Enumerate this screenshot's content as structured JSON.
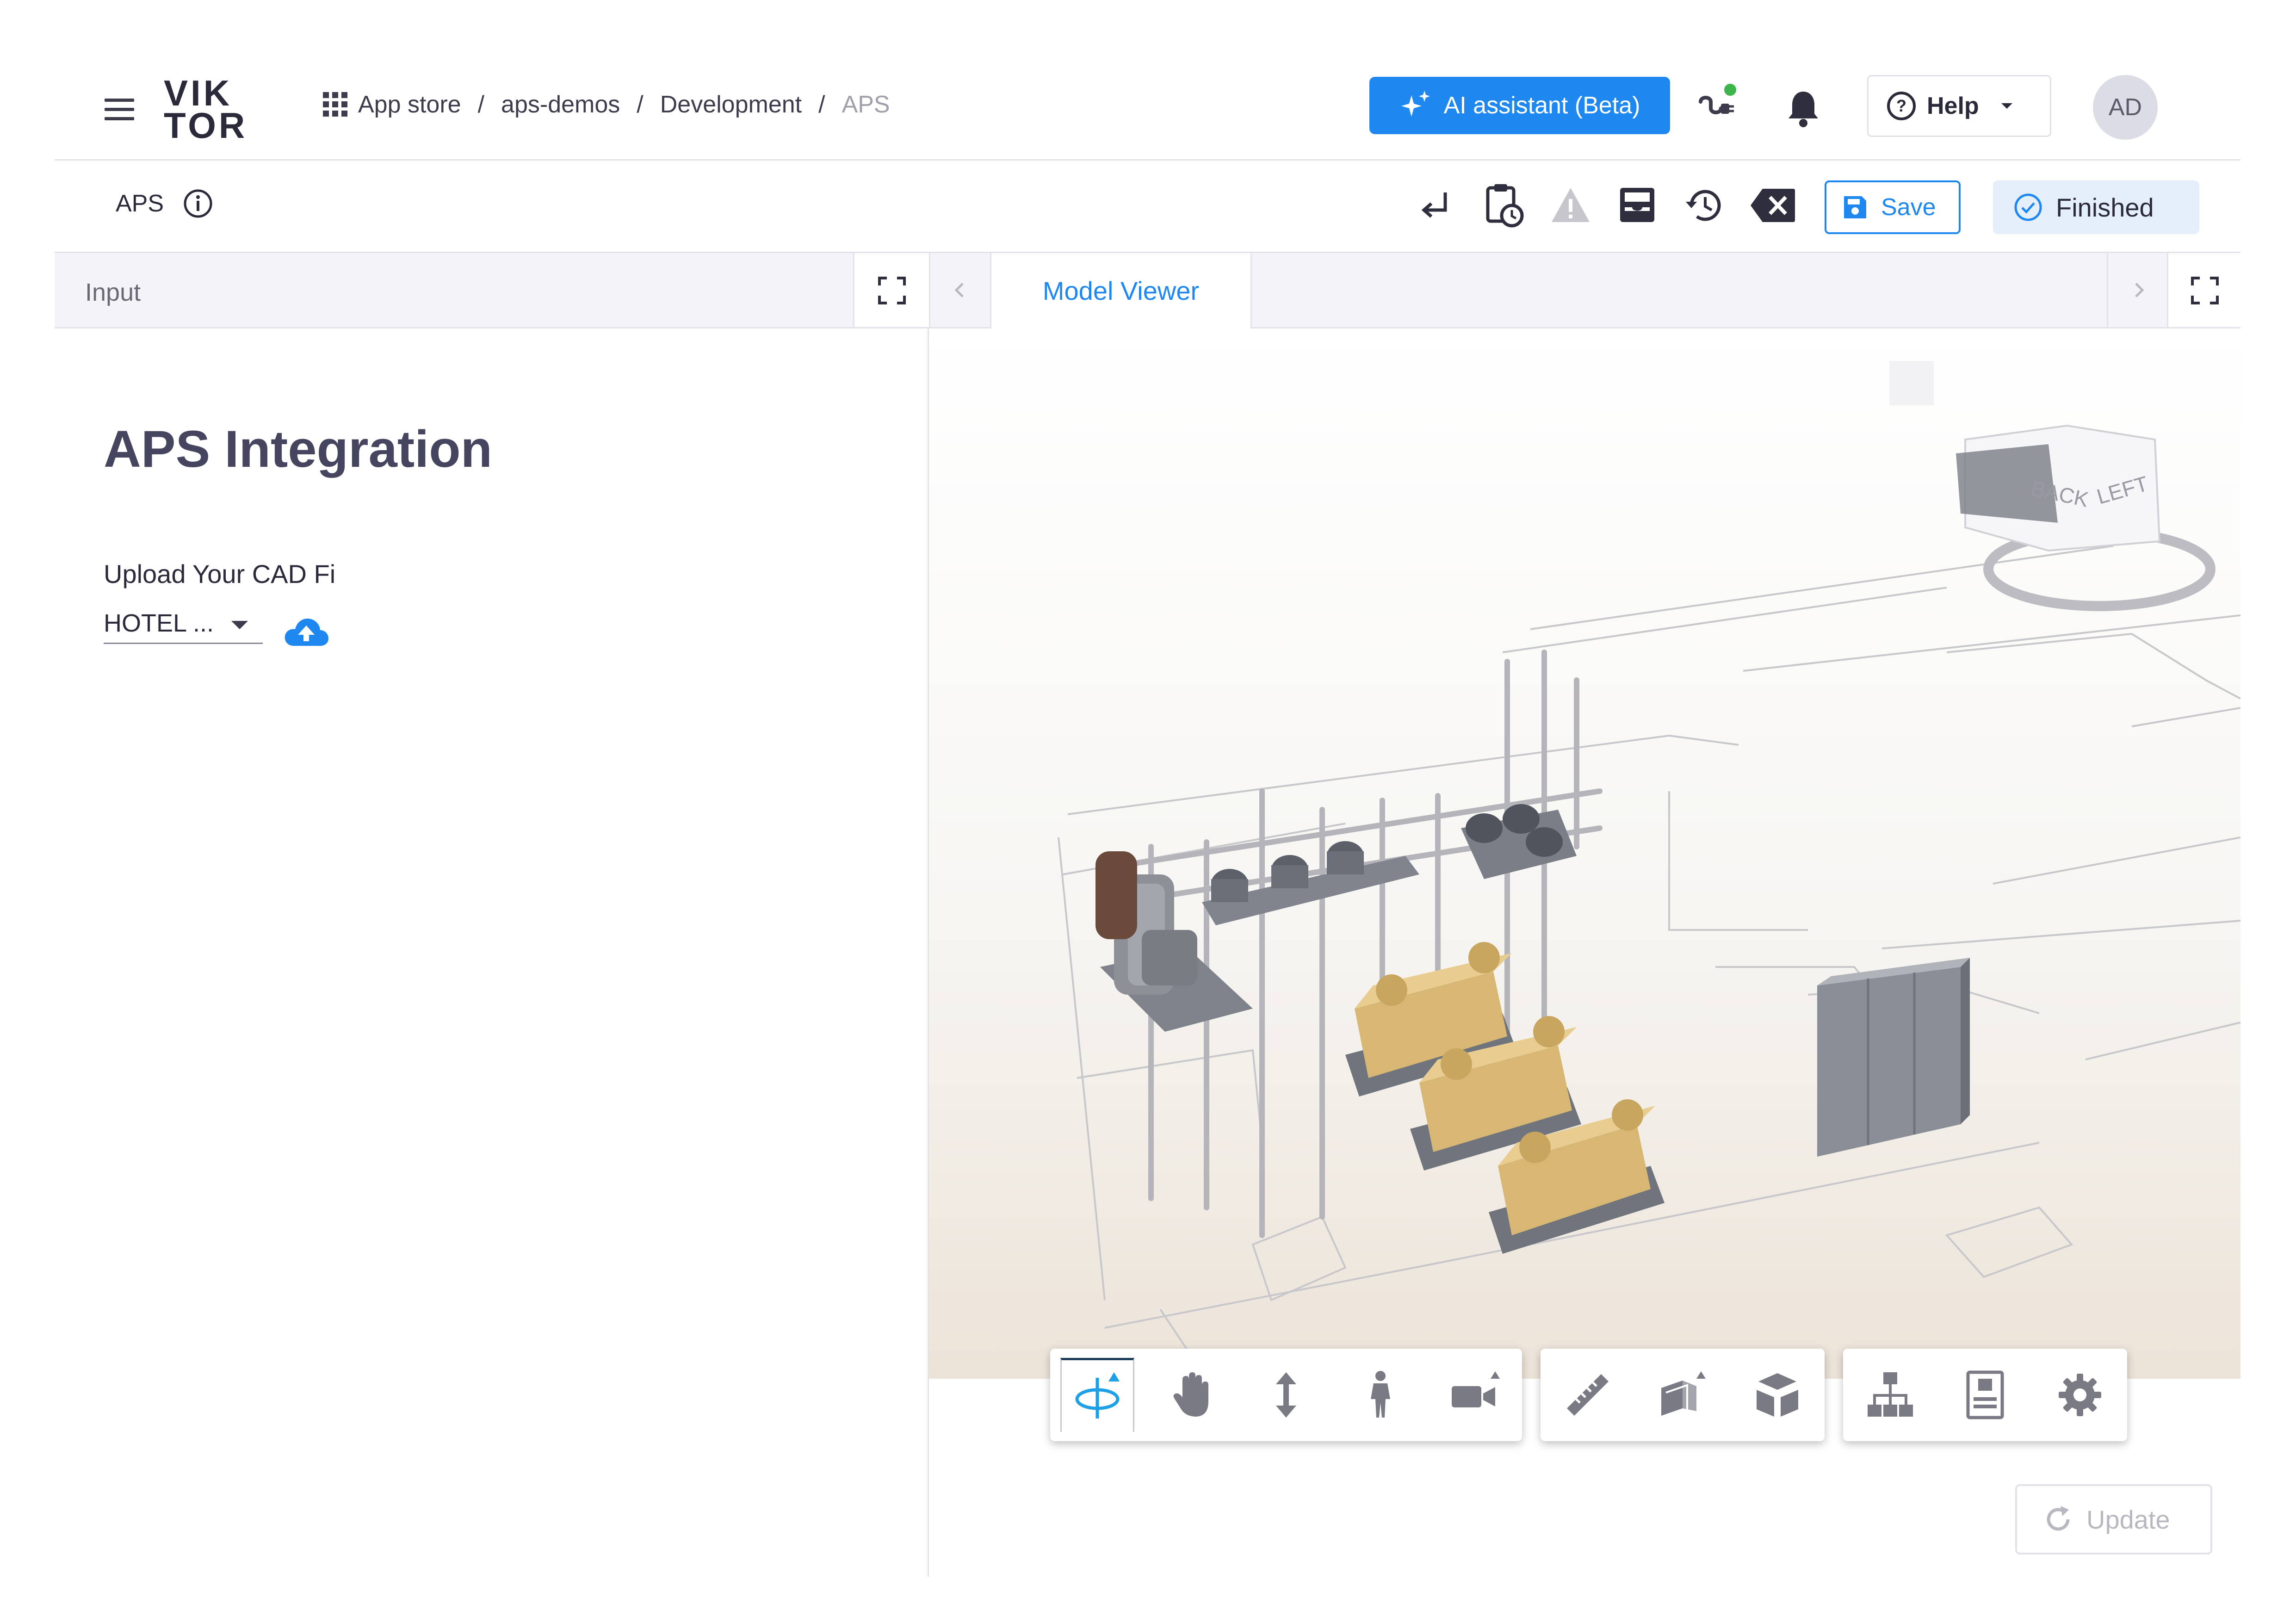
{
  "header": {
    "logo_line1": "VIK",
    "logo_line2": "TOR",
    "breadcrumbs": [
      "App store",
      "aps-demos",
      "Development",
      "APS"
    ],
    "breadcrumb_sep": "/",
    "ai_button": "AI assistant (Beta)",
    "help_button": "Help",
    "avatar": "AD",
    "status_dot_color": "#3cb54a"
  },
  "subbar": {
    "app_name": "APS",
    "save_label": "Save",
    "finished_label": "Finished"
  },
  "tabs": {
    "input_label": "Input",
    "viewer_label": "Model Viewer"
  },
  "input_panel": {
    "title": "APS Integration",
    "field_label": "Upload Your CAD Fi",
    "field_value": "HOTEL ..."
  },
  "viewer": {
    "viewcube_labels": [
      "BACK",
      "LEFT"
    ],
    "toolbar_groups": [
      [
        "orbit-icon",
        "pan-icon",
        "zoom-icon",
        "first-person-icon",
        "camera-icon"
      ],
      [
        "measure-icon",
        "section-icon",
        "explode-icon"
      ],
      [
        "model-browser-icon",
        "properties-icon",
        "settings-icon"
      ]
    ]
  },
  "update_label": "Update",
  "colors": {
    "accent": "#1e88f0",
    "text_dark": "#3a3a4a",
    "finished_bg": "#e5eff9"
  }
}
